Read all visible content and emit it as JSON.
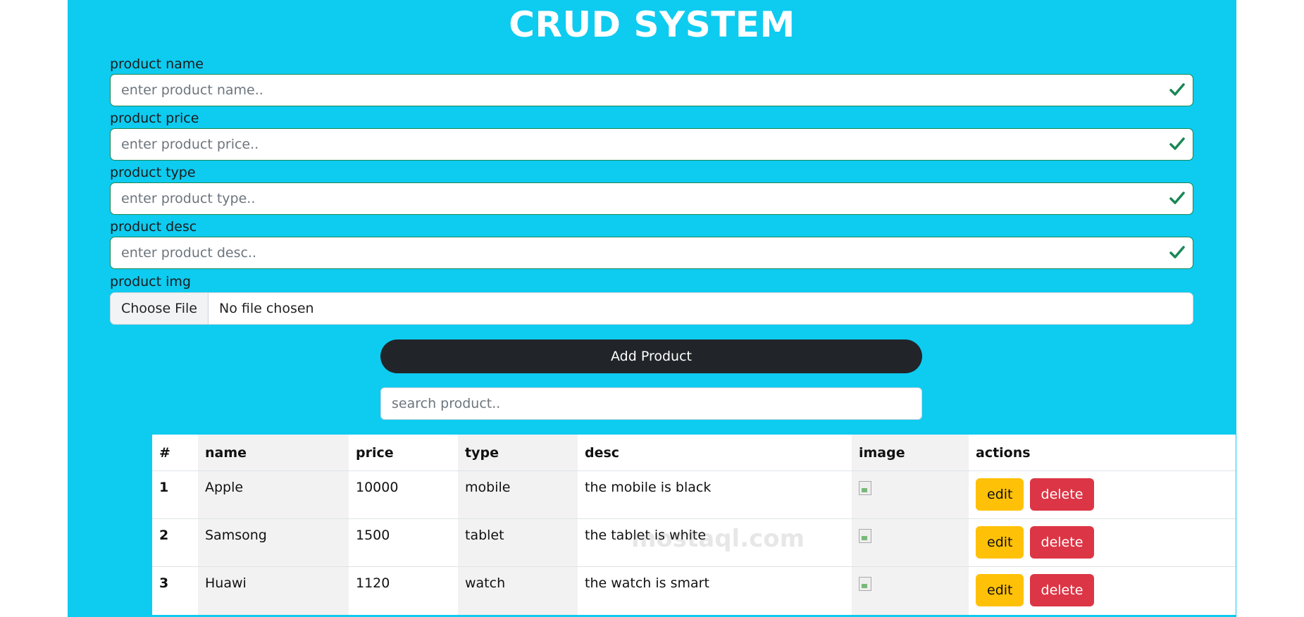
{
  "header": {
    "title": "CRUD SYSTEM"
  },
  "form": {
    "fields": [
      {
        "label": "product name",
        "placeholder": "enter product name.."
      },
      {
        "label": "product price",
        "placeholder": "enter product price.."
      },
      {
        "label": "product type",
        "placeholder": "enter product type.."
      },
      {
        "label": "product desc",
        "placeholder": "enter product desc.."
      }
    ],
    "image_label": "product img",
    "file_button": "Choose File",
    "file_status": "No file chosen",
    "submit_label": "Add Product",
    "valid_icon": "check-icon",
    "valid_color": "#198754"
  },
  "search": {
    "placeholder": "search product.."
  },
  "table": {
    "headers": [
      "#",
      "name",
      "price",
      "type",
      "desc",
      "image",
      "actions"
    ],
    "rows": [
      {
        "num": "1",
        "name": "Apple",
        "price": "10000",
        "type": "mobile",
        "desc": "the mobile is black"
      },
      {
        "num": "2",
        "name": "Samsong",
        "price": "1500",
        "type": "tablet",
        "desc": "the tablet is white"
      },
      {
        "num": "3",
        "name": "Huawi",
        "price": "1120",
        "type": "watch",
        "desc": "the watch is smart"
      }
    ],
    "edit_label": "edit",
    "delete_label": "delete"
  },
  "watermark": "mostaql.com",
  "colors": {
    "background": "#0ecbf0",
    "primary_button": "#212529",
    "edit_button": "#ffc107",
    "delete_button": "#dc3545"
  }
}
